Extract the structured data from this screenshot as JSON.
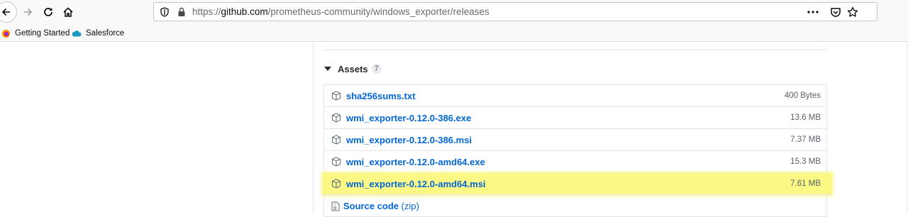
{
  "browser": {
    "url_prefix": "https://",
    "url_host": "github.com",
    "url_path": "/prometheus-community/windows_exporter/releases",
    "bookmarks": [
      {
        "label": "Getting Started",
        "icon": "firefox-icon"
      },
      {
        "label": "Salesforce",
        "icon": "salesforce-cloud-icon"
      }
    ]
  },
  "assets": {
    "title": "Assets",
    "count": "7",
    "items": [
      {
        "name": "sha256sums.txt",
        "size": "400 Bytes"
      },
      {
        "name": "wmi_exporter-0.12.0-386.exe",
        "size": "13.6 MB"
      },
      {
        "name": "wmi_exporter-0.12.0-386.msi",
        "size": "7.37 MB"
      },
      {
        "name": "wmi_exporter-0.12.0-amd64.exe",
        "size": "15.3 MB"
      },
      {
        "name": "wmi_exporter-0.12.0-amd64.msi",
        "size": "7.61 MB",
        "highlighted": true
      }
    ],
    "source": {
      "label": "Source code",
      "format": "(zip)"
    }
  },
  "colors": {
    "link": "#0366d6",
    "highlight": "#fbf886"
  }
}
